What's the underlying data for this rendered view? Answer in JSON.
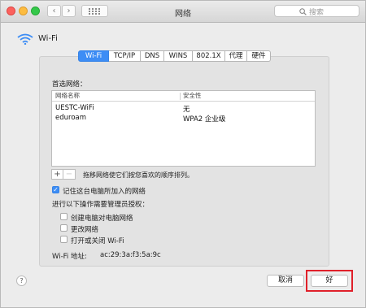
{
  "window": {
    "title": "网络"
  },
  "search": {
    "placeholder": "搜索"
  },
  "header": {
    "interface_name": "Wi-Fi"
  },
  "tabs": [
    {
      "label": "Wi-Fi",
      "active": true
    },
    {
      "label": "TCP/IP"
    },
    {
      "label": "DNS"
    },
    {
      "label": "WINS"
    },
    {
      "label": "802.1X"
    },
    {
      "label": "代理"
    },
    {
      "label": "硬件"
    }
  ],
  "preferred": {
    "section_label": "首选网络：",
    "columns": {
      "name": "网络名称",
      "security": "安全性"
    },
    "rows": [
      {
        "name": "UESTC-WiFi",
        "security": "无"
      },
      {
        "name": "eduroam",
        "security": "WPA2 企业级"
      }
    ],
    "add_label": "+",
    "remove_label": "−",
    "hint": "拖移网络使它们按您喜欢的顺序排列。"
  },
  "remember": {
    "label": "记住这台电脑所加入的网络",
    "checked": true
  },
  "admin": {
    "section_label": "进行以下操作需要管理员授权：",
    "options": [
      {
        "label": "创建电脑对电脑网络",
        "checked": false
      },
      {
        "label": "更改网络",
        "checked": false
      },
      {
        "label": "打开或关闭 Wi-Fi",
        "checked": false
      }
    ]
  },
  "address": {
    "label": "Wi-Fi 地址:",
    "value": "ac:29:3a:f3:5a:9c"
  },
  "buttons": {
    "cancel": "取消",
    "ok": "好",
    "help": "?"
  },
  "colors": {
    "accent": "#3d8df5",
    "highlight_box": "#e0202a"
  }
}
